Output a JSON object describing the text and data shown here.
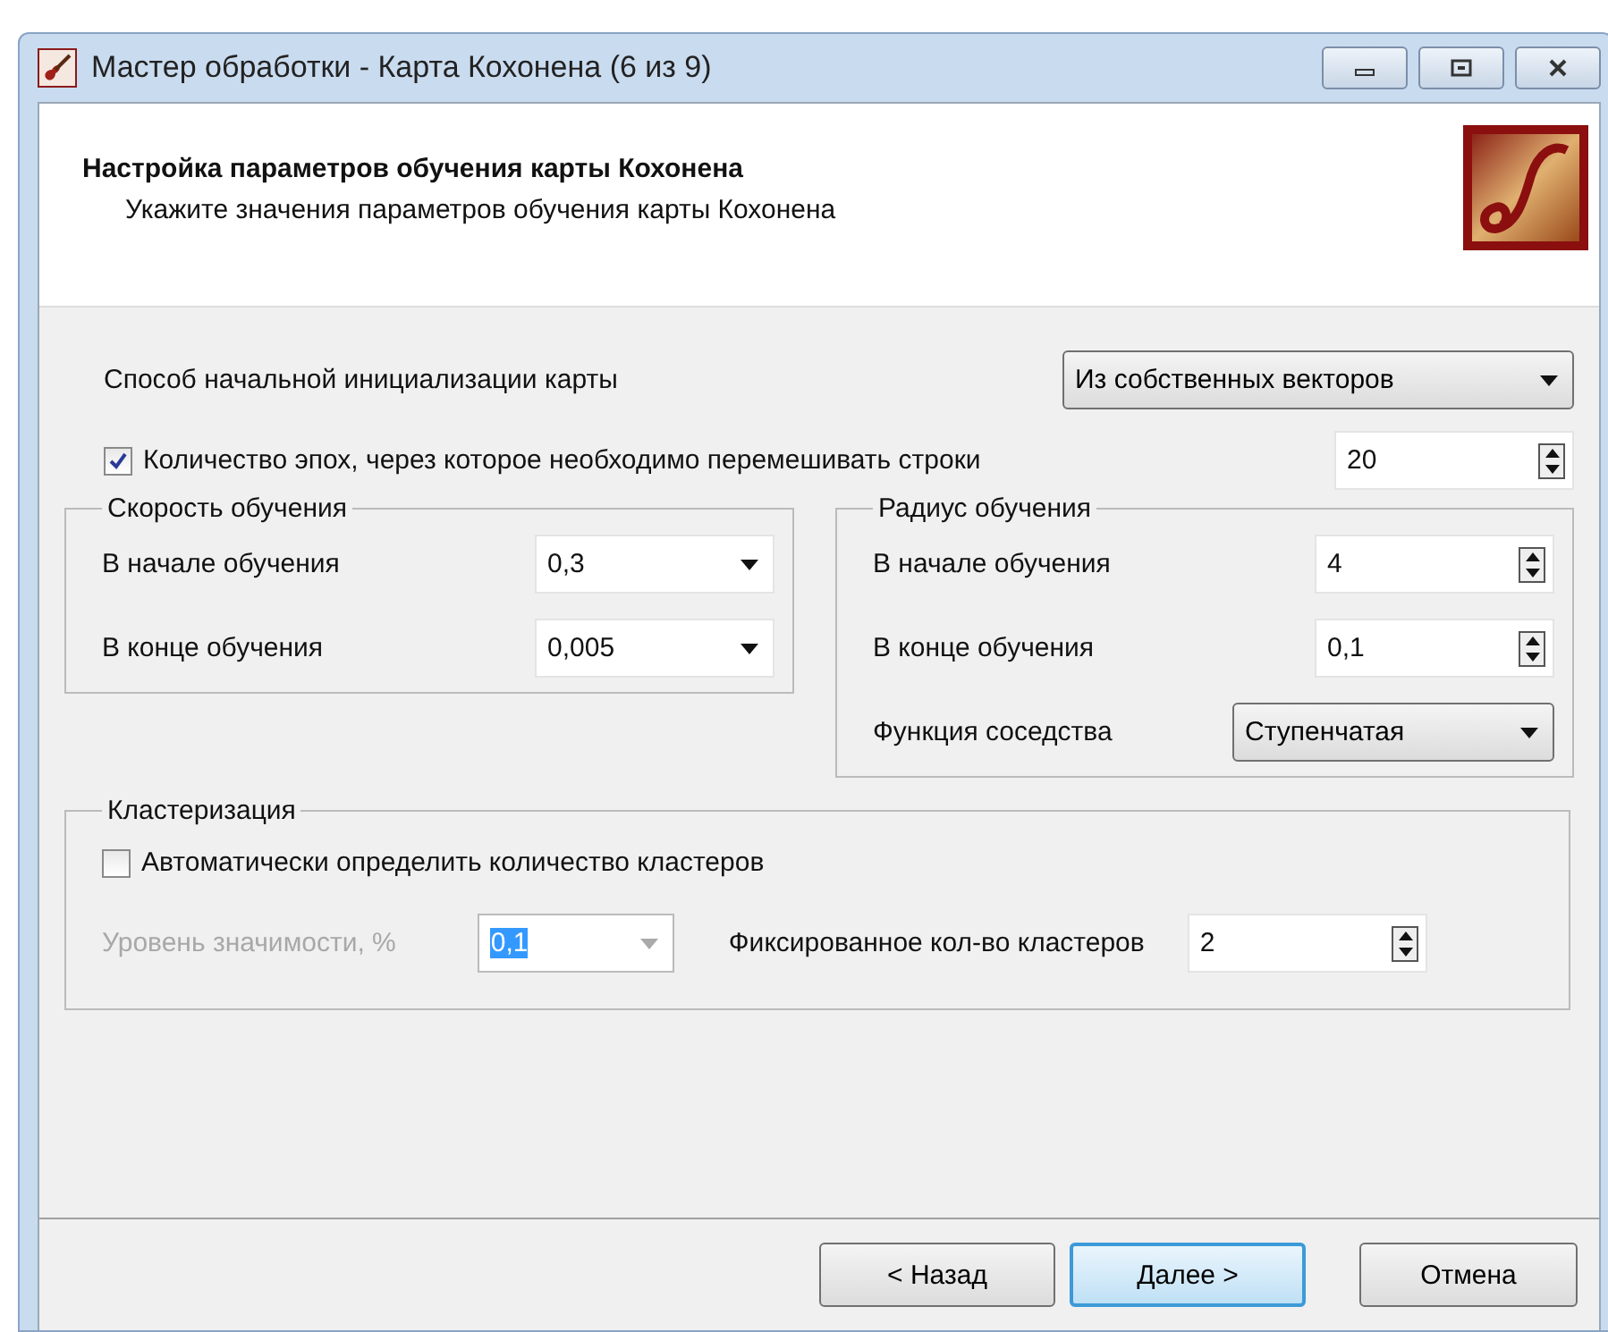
{
  "window": {
    "title": "Мастер обработки - Карта Кохонена (6 из 9)"
  },
  "header": {
    "title": "Настройка параметров обучения карты Кохонена",
    "subtitle": "Укажите значения параметров обучения карты Кохонена"
  },
  "init_method": {
    "label": "Способ начальной инициализации карты",
    "value": "Из собственных векторов"
  },
  "shuffle": {
    "label": "Количество эпох, через которое необходимо перемешивать строки",
    "checked": true,
    "value": "20"
  },
  "learning_rate": {
    "title": "Скорость обучения",
    "fields": [
      {
        "label": "В начале обучения",
        "value": "0,3",
        "kind": "combo"
      },
      {
        "label": "В конце обучения",
        "value": "0,005",
        "kind": "combo"
      }
    ]
  },
  "learning_radius": {
    "title": "Радиус обучения",
    "fields": [
      {
        "label": "В начале обучения",
        "value": "4",
        "kind": "spin"
      },
      {
        "label": "В конце обучения",
        "value": "0,1",
        "kind": "spin"
      },
      {
        "label": "Функция соседства",
        "value": "Ступенчатая",
        "kind": "dropdown"
      }
    ]
  },
  "clustering": {
    "title": "Кластеризация",
    "auto": {
      "label": "Автоматически определить количество кластеров",
      "checked": false
    },
    "significance": {
      "label": "Уровень значимости, %",
      "value": "0,1",
      "disabled": true,
      "text_selected": true
    },
    "fixed": {
      "label": "Фиксированное кол-во кластеров",
      "value": "2"
    }
  },
  "buttons": [
    {
      "label": "< Назад",
      "default": false
    },
    {
      "label": "Далее >",
      "default": true
    },
    {
      "label": "Отмена",
      "default": false
    }
  ]
}
